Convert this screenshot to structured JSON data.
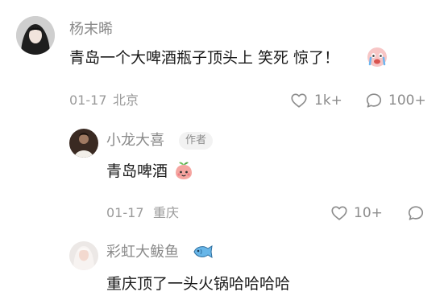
{
  "comments": [
    {
      "username": "杨末晞",
      "text": "青岛一个大啤酒瓶子顶头上 笑死 惊了！",
      "date": "01-17",
      "location": "北京",
      "likes": "1k+",
      "replies": "100+",
      "emoji": "crying-face-emoji"
    },
    {
      "username": "小龙大喜",
      "badge": "作者",
      "text": "青岛啤酒",
      "date": "01-17",
      "location": "重庆",
      "likes": "10+",
      "emoji": "peach-face-emoji"
    },
    {
      "username": "彩虹大鲅鱼",
      "text": "重庆顶了一头火锅哈哈哈哈",
      "emoji": "fish-emoji"
    }
  ],
  "icons": {
    "like": "heart-icon",
    "reply": "comment-bubble-icon"
  },
  "colors": {
    "name": "#8a8a8a",
    "text": "#1a1a1a",
    "meta": "#9a9a9a",
    "badge_bg": "#f2f2f2"
  }
}
